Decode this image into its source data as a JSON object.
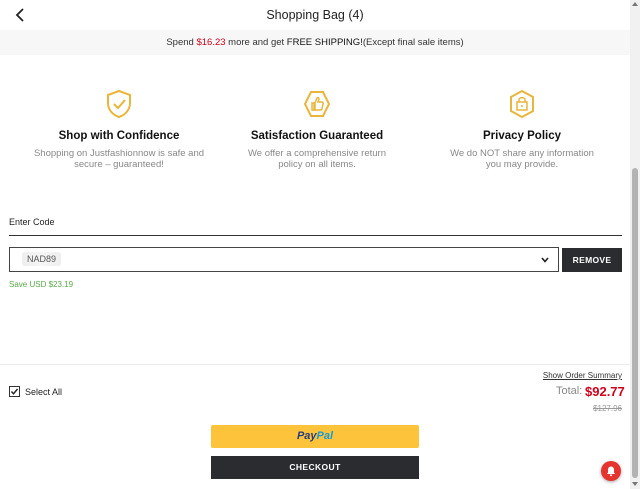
{
  "header": {
    "title": "Shopping Bag (4)",
    "back_icon": "chevron-left-icon"
  },
  "shipping_bar": {
    "prefix": "Spend ",
    "amount": "$16.23",
    "middle": " more and get ",
    "free_text": "FREE SHIPPING!",
    "suffix": "(Except final sale items)"
  },
  "features": [
    {
      "icon": "shield-check-icon",
      "title": "Shop with Confidence",
      "desc_line1": "Shopping on Justfashionnow is safe and",
      "desc_line2": "secure – guaranteed!"
    },
    {
      "icon": "thumbs-up-icon",
      "title": "Satisfaction Guaranteed",
      "desc_line1": "We offer a comprehensive return",
      "desc_line2": "policy on all items."
    },
    {
      "icon": "padlock-icon",
      "title": "Privacy Policy",
      "desc_line1": "We do NOT share any information",
      "desc_line2": "you may provide."
    }
  ],
  "coupon": {
    "label": "Enter Code",
    "selected_code": "NAD89",
    "remove_label": "REMOVE",
    "savings_text": "Save USD $23.19"
  },
  "summary": {
    "select_all_label": "Select All",
    "select_all_checked": true,
    "order_summary_link": "Show Order Summary",
    "total_label": "Total:",
    "total_value": "$92.77",
    "original_price": "$127.96"
  },
  "buttons": {
    "paypal_part1": "Pay",
    "paypal_part2": "Pal",
    "checkout_label": "CHECKOUT"
  },
  "colors": {
    "accent_red": "#d0021b",
    "icon_gold": "#e8b63a",
    "paypal_yellow": "#fdc33a",
    "dark_button": "#2b2c30",
    "savings_green": "#5aa84a"
  }
}
